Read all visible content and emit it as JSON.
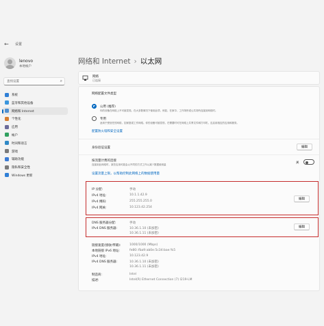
{
  "window": {
    "back_glyph": "←",
    "title": "设置"
  },
  "profile": {
    "name": "lenovo",
    "type": "本地帐户"
  },
  "search": {
    "placeholder": "查找设置"
  },
  "sidebar": {
    "items": [
      {
        "label": "系统",
        "color": "#2f7fd6"
      },
      {
        "label": "蓝牙和其他设备",
        "color": "#3a96dd"
      },
      {
        "label": "网络和 Internet",
        "color": "#4e8fd1",
        "active": true
      },
      {
        "label": "个性化",
        "color": "#d67d2f"
      },
      {
        "label": "应用",
        "color": "#6b6b9a"
      },
      {
        "label": "帐户",
        "color": "#31a05f"
      },
      {
        "label": "时间和语言",
        "color": "#2f89c6"
      },
      {
        "label": "游戏",
        "color": "#7a7a7a"
      },
      {
        "label": "辅助功能",
        "color": "#3b7bd4"
      },
      {
        "label": "隐私和安全性",
        "color": "#7a7a7a"
      },
      {
        "label": "Windows 更新",
        "color": "#2f7fd6"
      }
    ]
  },
  "breadcrumb": {
    "parent": "网络和 Internet",
    "separator": "›",
    "current": "以太网"
  },
  "network": {
    "name": "网络",
    "status": "已连接"
  },
  "profile_type": {
    "label": "网络配置文件类型",
    "public_label": "公用 (推荐)",
    "public_desc": "你的设备在网络上不可被发现。在大多数情况下使用此项，例如，在家中、工作场所或公共场所连接到网络时。",
    "private_label": "专用",
    "private_desc": "适用于受信任的网络，如家庭或工作网络。你的设备可被发现，在需要时可在网络上共享文件和打印机，应启用相应的应用和服务。",
    "firewall_link": "配置防火墙和安全设置"
  },
  "auth": {
    "label": "身份验证设置",
    "button": "编辑"
  },
  "metered": {
    "label": "按流量计费的连接",
    "desc": "连接到此网络时，某些应用可能会以不同的方式工作以减少数据使用量",
    "state": "关",
    "link": "设置流量上限，以帮助控制此网络上的数据使用量"
  },
  "ip": {
    "assign_label": "IP 分配:",
    "assign_value": "手动",
    "addr_label": "IPv4 地址:",
    "addr_value": "10.1.1.42.9",
    "mask_label": "IPv4 掩码:",
    "mask_value": "255.255.255.0",
    "gw_label": "IPv4 网关:",
    "gw_value": "10.123.42.254",
    "button": "编辑"
  },
  "dns": {
    "assign_label": "DNS 服务器分配:",
    "assign_value": "手动",
    "server_label": "IPv4 DNS 服务器:",
    "server_value_1": "10.36.1.10 (未加密)",
    "server_value_2": "10.36.1.11 (未加密)",
    "button": "编辑"
  },
  "info": {
    "speed_label": "链接速度(接收/传输):",
    "speed_value": "1000/1000 (Mbps)",
    "ipv6_label": "本地链接 IPv6 地址:",
    "ipv6_value": "fe80::fba9:ab0e:5c34:bae:%5",
    "ipv4_label": "IPv4 地址:",
    "ipv4_value": "10.123.42.9",
    "dns_label": "IPv4 DNS 服务器:",
    "dns_value_1": "10.36.1.10 (未加密)",
    "dns_value_2": "10.36.1.11 (未加密)",
    "mfr_label": "制造商:",
    "mfr_value": "Intel",
    "desc_label": "描述:",
    "desc_value": "Intel(R) Ethernet Connection (7) I219-LM"
  }
}
